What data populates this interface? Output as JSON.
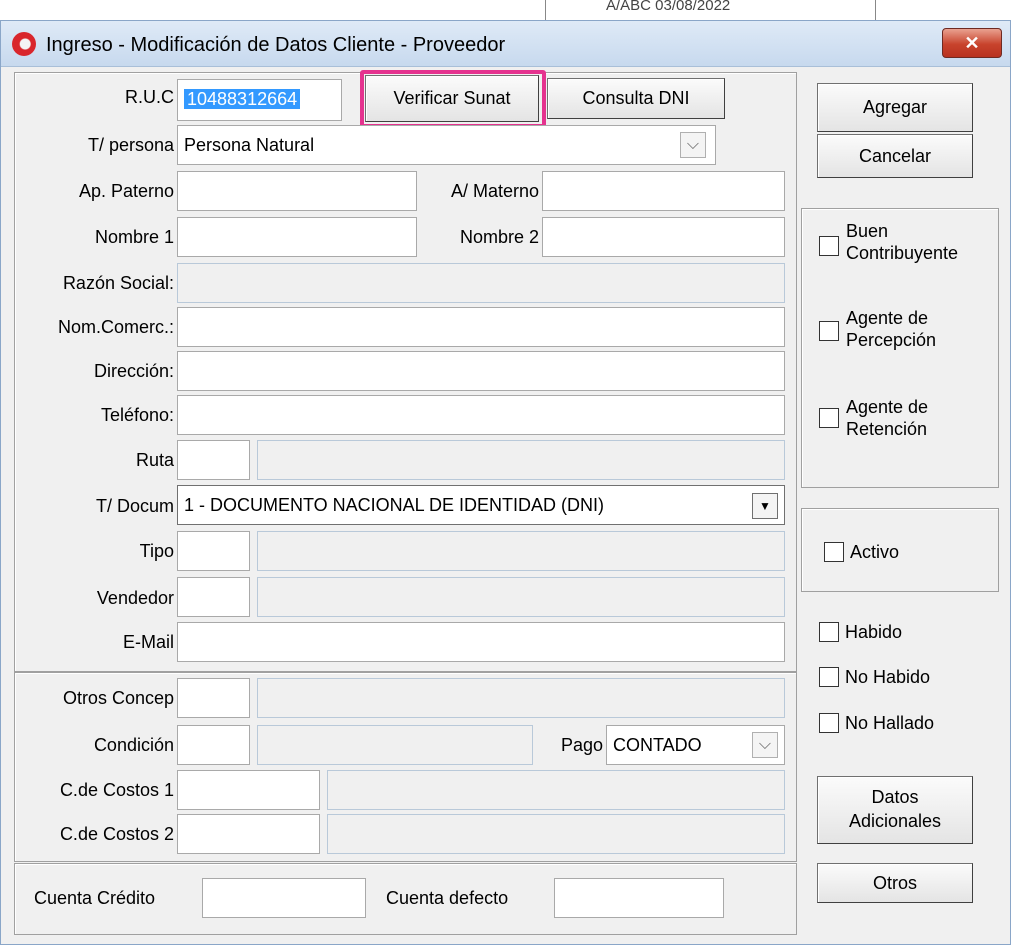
{
  "window": {
    "title": "Ingreso - Modificación de Datos Cliente - Proveedor",
    "close_label": "✕",
    "close_color": "#c8432c"
  },
  "background": {
    "partial_text": "A/ABC  03/08/2022"
  },
  "form": {
    "ruc": {
      "label": "R.U.C",
      "value": "10488312664"
    },
    "verificar_sunat": "Verificar Sunat",
    "consulta_dni": "Consulta DNI",
    "tipo_persona": {
      "label": "T/ persona",
      "value": "Persona Natural"
    },
    "ap_paterno": {
      "label": "Ap. Paterno",
      "value": ""
    },
    "ap_materno": {
      "label": "A/ Materno",
      "value": ""
    },
    "nombre1": {
      "label": "Nombre 1",
      "value": ""
    },
    "nombre2": {
      "label": "Nombre 2",
      "value": ""
    },
    "razon_social": {
      "label": "Razón Social:",
      "value": ""
    },
    "nom_comerc": {
      "label": "Nom.Comerc.:",
      "value": ""
    },
    "direccion": {
      "label": "Dirección:",
      "value": ""
    },
    "telefono": {
      "label": "Teléfono:",
      "value": ""
    },
    "ruta": {
      "label": "Ruta",
      "code": "",
      "desc": ""
    },
    "tipo_docum": {
      "label": "T/ Docum",
      "value": "1 - DOCUMENTO NACIONAL DE IDENTIDAD (DNI)"
    },
    "tipo": {
      "label": "Tipo",
      "code": "",
      "desc": ""
    },
    "vendedor": {
      "label": "Vendedor",
      "code": "",
      "desc": ""
    },
    "email": {
      "label": "E-Mail",
      "value": ""
    },
    "otros_concep": {
      "label": "Otros Concep",
      "code": "",
      "desc": ""
    },
    "condicion": {
      "label": "Condición",
      "code": "",
      "desc": ""
    },
    "pago": {
      "label": "Pago",
      "value": "CONTADO"
    },
    "costos1": {
      "label": "C.de Costos 1",
      "code": "",
      "desc": ""
    },
    "costos2": {
      "label": "C.de Costos 2",
      "code": "",
      "desc": ""
    },
    "cuenta_credito": {
      "label": "Cuenta Crédito",
      "value": ""
    },
    "cuenta_defecto": {
      "label": "Cuenta defecto",
      "value": ""
    }
  },
  "side": {
    "agregar": "Agregar",
    "cancelar": "Cancelar",
    "buen_contribuyente": {
      "line1": "Buen",
      "line2": "Contribuyente",
      "checked": false
    },
    "agente_percepcion": {
      "line1": "Agente de",
      "line2": "Percepción",
      "checked": false
    },
    "agente_retencion": {
      "line1": "Agente de",
      "line2": "Retención",
      "checked": false
    },
    "activo": {
      "label": "Activo",
      "checked": false
    },
    "habido": {
      "label": "Habido",
      "checked": false
    },
    "no_habido": {
      "label": "No Habido",
      "checked": false
    },
    "no_hallado": {
      "label": "No Hallado",
      "checked": false
    },
    "datos_adicionales": {
      "line1": "Datos",
      "line2": "Adicionales"
    },
    "otros": "Otros"
  },
  "highlight_color": "#e5338f"
}
